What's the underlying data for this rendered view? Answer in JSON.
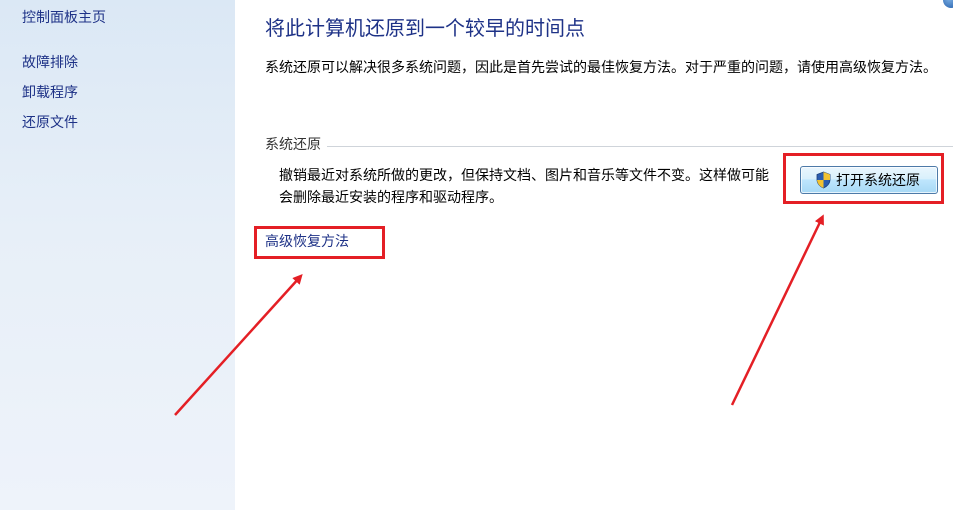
{
  "sidebar": {
    "home_link": "控制面板主页",
    "items": [
      {
        "label": "故障排除"
      },
      {
        "label": "卸载程序"
      },
      {
        "label": "还原文件"
      }
    ]
  },
  "main": {
    "title": "将此计算机还原到一个较早的时间点",
    "intro": "系统还原可以解决很多系统问题，因此是首先尝试的最佳恢复方法。对于严重的问题，请使用高级恢复方法。",
    "system_restore": {
      "section_title": "系统还原",
      "description": "撤销最近对系统所做的更改，但保持文档、图片和音乐等文件不变。这样做可能会删除最近安装的程序和驱动程序。",
      "button_label": "打开系统还原"
    },
    "advanced_link": "高级恢复方法"
  },
  "colors": {
    "link": "#1e3287",
    "annotation_red": "#e41f25",
    "sidebar_bg": "#dbe8f5"
  },
  "icons": {
    "restore_button_icon": "uac-shield-icon",
    "corner_icon": "help-icon"
  }
}
